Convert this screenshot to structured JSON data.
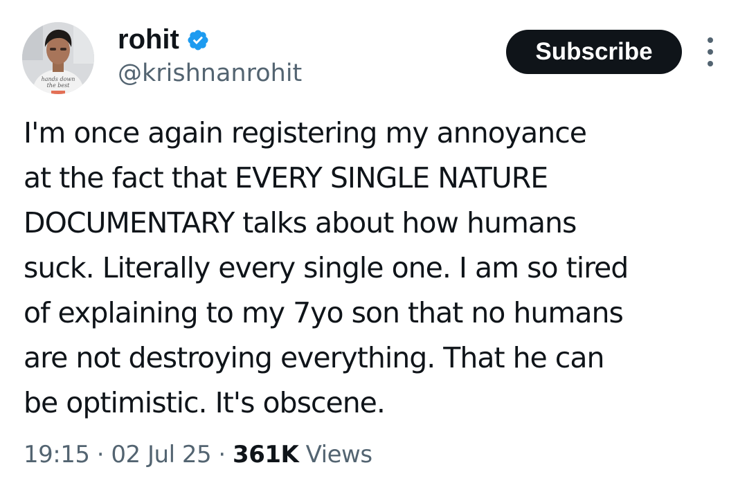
{
  "author": {
    "display_name": "rohit",
    "handle": "@krishnanrohit",
    "verified": true,
    "avatar": "profile-photo",
    "avatar_shirt_text": "hands down the best"
  },
  "actions": {
    "subscribe_label": "Subscribe",
    "more_icon": "more-vertical-icon"
  },
  "tweet": {
    "text": "I'm once again registering my annoyance\nat the fact that EVERY SINGLE NATURE\nDOCUMENTARY talks about how humans\nsuck. Literally every single one. I am so tired\nof explaining to my 7yo son that no humans\nare not destroying everything. That he can\nbe optimistic. It's obscene."
  },
  "meta": {
    "time": "19:15",
    "separator": " · ",
    "date": "02 Jul 25",
    "views_count": "361K",
    "views_label": " Views"
  },
  "colors": {
    "text_primary": "#0f1419",
    "text_secondary": "#536471",
    "verified_blue": "#1d9bf0",
    "button_background": "#0f1419",
    "button_text": "#ffffff"
  }
}
